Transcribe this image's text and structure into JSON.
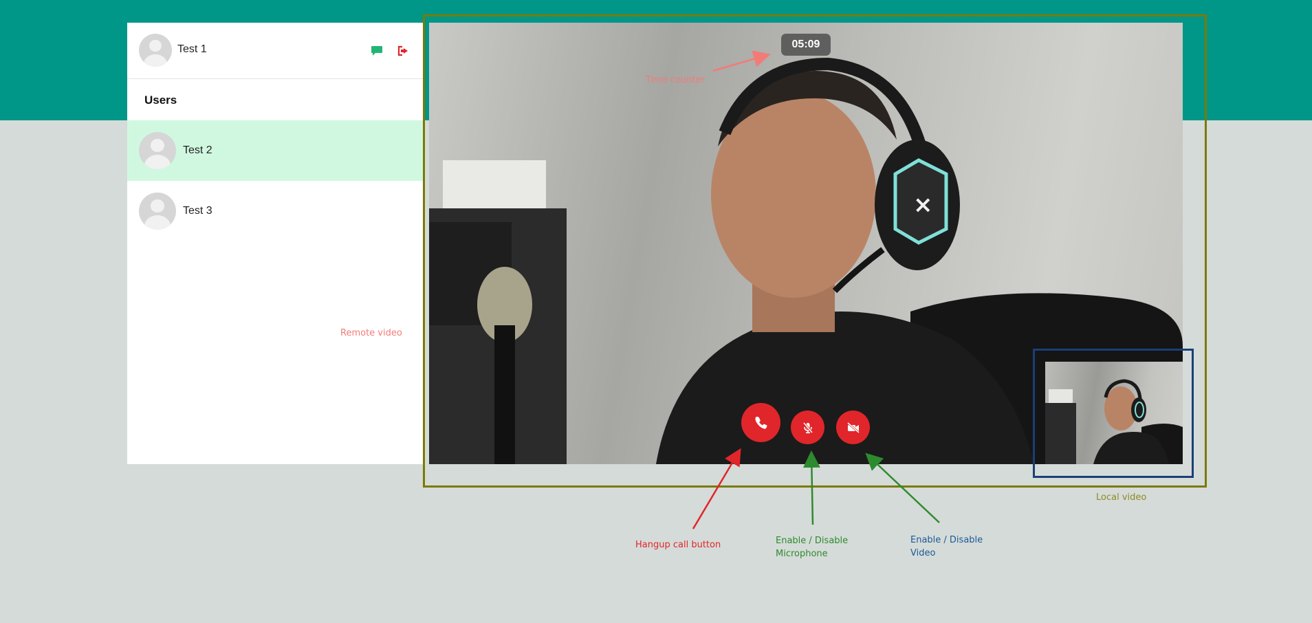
{
  "current_user": {
    "name": "Test 1"
  },
  "sidebar": {
    "title": "Users",
    "users": [
      {
        "name": "Test 2",
        "active": true
      },
      {
        "name": "Test 3",
        "active": false
      }
    ]
  },
  "call": {
    "timer": "05:09"
  },
  "annotations": {
    "time_counter": "Time counter",
    "remote_video": "Remote video",
    "local_video": "Local video",
    "hangup": "Hangup call button",
    "mic_line1": "Enable / Disable",
    "mic_line2": "Microphone",
    "video_line1": "Enable / Disable",
    "video_line2": "Video"
  },
  "colors": {
    "header_teal": "#009688",
    "active_user": "#d0f8e0",
    "call_button_red": "#e0262b",
    "chat_icon_green": "#21b573",
    "remote_box_olive": "#7a7a00",
    "local_box_blue": "#1a3f78"
  },
  "icons": {
    "chat": "chat-bubble-icon",
    "logout": "sign-out-icon",
    "hangup": "phone-icon",
    "mic": "microphone-slash-icon",
    "camera": "video-slash-icon"
  }
}
